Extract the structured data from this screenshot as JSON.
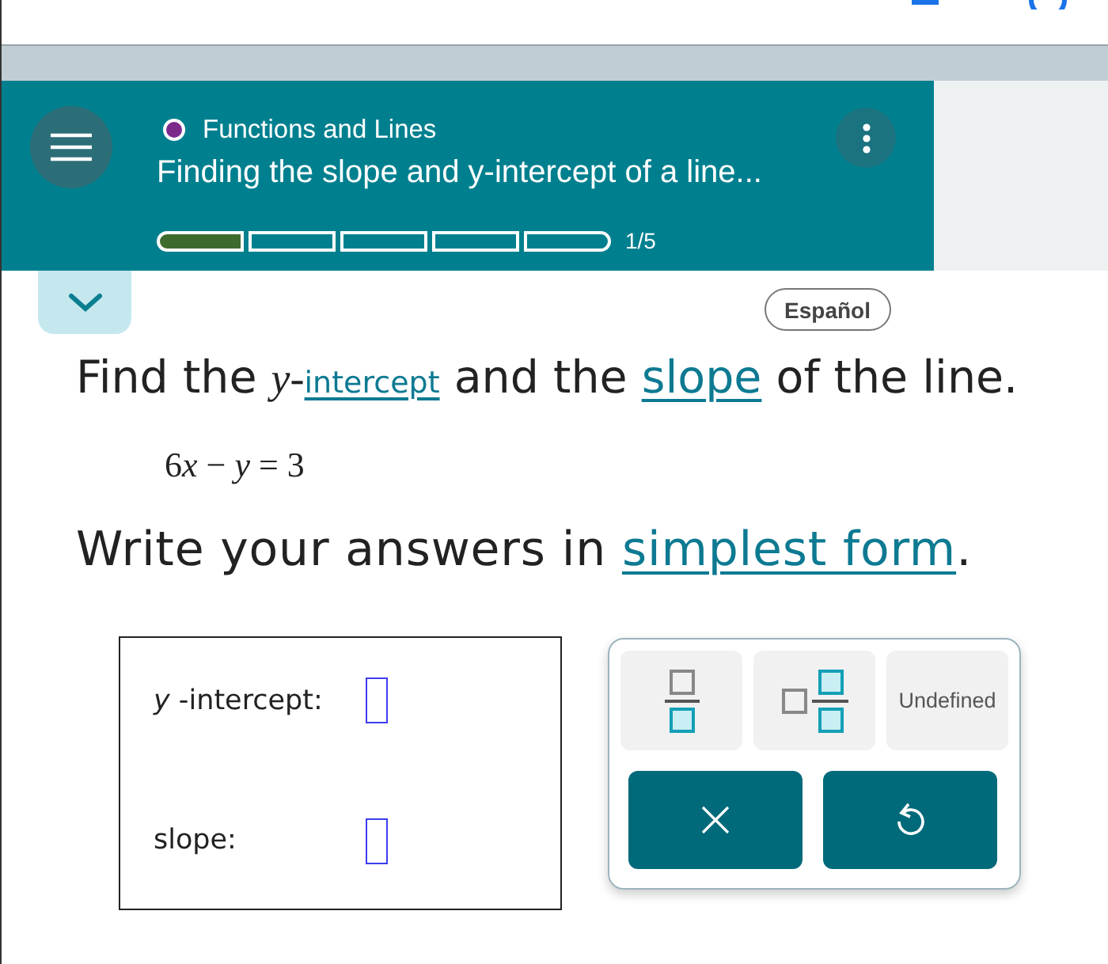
{
  "header": {
    "topic": "Functions and Lines",
    "title": "Finding the slope and y-intercept of a line...",
    "progress": {
      "segments": [
        {
          "done": true
        },
        {
          "done": false
        },
        {
          "done": false
        },
        {
          "done": false
        },
        {
          "done": false
        }
      ],
      "label": "1/5"
    }
  },
  "language_button": "Español",
  "question": {
    "sentence": [
      {
        "kind": "text",
        "text": "Find the "
      },
      {
        "kind": "math",
        "text": "y-"
      },
      {
        "kind": "term-link",
        "text": "intercept"
      },
      {
        "kind": "text",
        "text": " and the "
      },
      {
        "kind": "link",
        "text": "slope"
      },
      {
        "kind": "text",
        "text": " of the line."
      }
    ],
    "equation": [
      {
        "kind": "text",
        "text": "6"
      },
      {
        "kind": "var",
        "text": "x"
      },
      {
        "kind": "text",
        "text": " − "
      },
      {
        "kind": "var",
        "text": "y"
      },
      {
        "kind": "text",
        "text": " = 3"
      }
    ],
    "instruction": [
      {
        "kind": "text",
        "text": "Write your answers in "
      },
      {
        "kind": "link",
        "text": "simplest form"
      },
      {
        "kind": "text",
        "text": "."
      }
    ]
  },
  "answers": [
    {
      "label": "*y* -intercept:"
    },
    {
      "label": "slope:"
    }
  ],
  "keypad": {
    "rows": [
      {
        "keys": [
          {
            "kind": "fraction"
          },
          {
            "kind": "mixed-number"
          },
          {
            "kind": "text",
            "label": "Undefined"
          }
        ]
      },
      {
        "keys": [
          {
            "kind": "clear"
          },
          {
            "kind": "undo"
          }
        ]
      }
    ]
  }
}
